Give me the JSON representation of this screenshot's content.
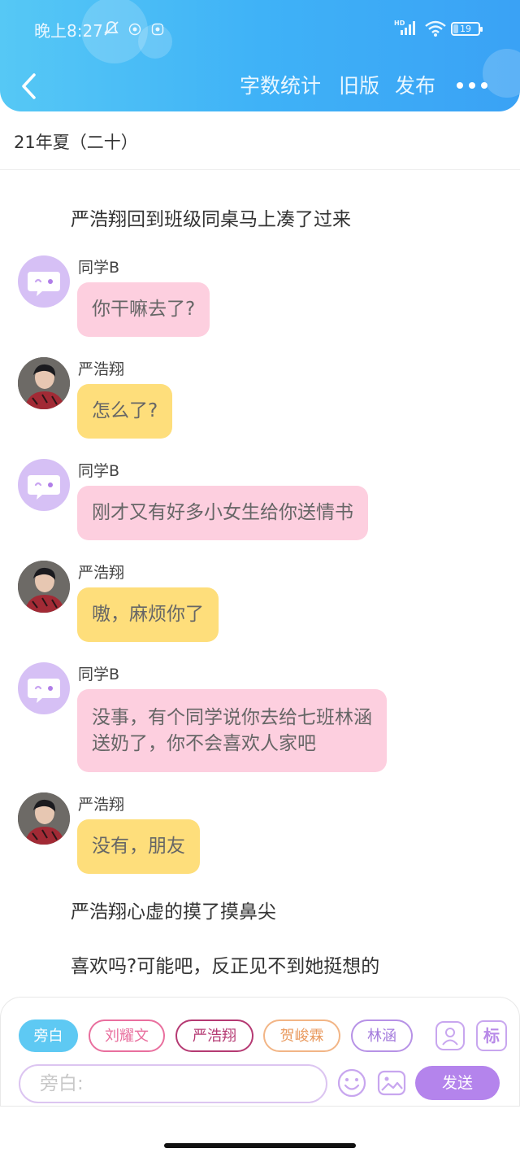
{
  "status_bar": {
    "time": "晚上8:27",
    "battery": "19",
    "battery_level": 0.19,
    "icons": [
      "mute-bell-icon",
      "app-badge-icon",
      "app-badge-icon",
      "hd-signal-icon",
      "wifi-icon",
      "battery-icon"
    ]
  },
  "header": {
    "back_icon": "chevron-left-icon",
    "actions": {
      "word_count": "字数统计",
      "old_version": "旧版",
      "publish": "发布"
    },
    "more_icon": "more-dots-icon",
    "colors": {
      "gradient_start": "#56c8f5",
      "gradient_end": "#3aa2f5"
    }
  },
  "chapter": {
    "title": "21年夏（二十）"
  },
  "story": {
    "items": [
      {
        "kind": "narration",
        "text": "严浩翔回到班级同桌马上凑了过来"
      },
      {
        "kind": "message",
        "speaker": "同学B",
        "avatar": "bot-face-icon",
        "color": "pink",
        "lines": [
          "你干嘛去了?"
        ]
      },
      {
        "kind": "message",
        "speaker": "严浩翔",
        "avatar": "user-photo",
        "color": "yellow",
        "lines": [
          "怎么了?"
        ]
      },
      {
        "kind": "message",
        "speaker": "同学B",
        "avatar": "bot-face-icon",
        "color": "pink",
        "lines": [
          "刚才又有好多小女生给你送情书"
        ]
      },
      {
        "kind": "message",
        "speaker": "严浩翔",
        "avatar": "user-photo",
        "color": "yellow",
        "lines": [
          "嗷，麻烦你了"
        ]
      },
      {
        "kind": "message",
        "speaker": "同学B",
        "avatar": "bot-face-icon",
        "color": "pink",
        "lines": [
          "没事，有个同学说你去给七班林涵",
          "送奶了，你不会喜欢人家吧"
        ]
      },
      {
        "kind": "message",
        "speaker": "严浩翔",
        "avatar": "user-photo",
        "color": "yellow",
        "lines": [
          "没有，朋友"
        ]
      },
      {
        "kind": "narration",
        "text": "严浩翔心虚的摸了摸鼻尖"
      },
      {
        "kind": "narration",
        "text": "喜欢吗?可能吧，反正见不到她挺想的"
      }
    ],
    "bubble_colors": {
      "pink": "#fdcfdf",
      "yellow": "#fede7b"
    }
  },
  "composer": {
    "roles": [
      {
        "label": "旁白",
        "selected": true,
        "color": "#5ec9f3"
      },
      {
        "label": "刘耀文",
        "selected": false,
        "color": "#e96f9e"
      },
      {
        "label": "严浩翔",
        "selected": false,
        "color": "#b53a73"
      },
      {
        "label": "贺峻霖",
        "selected": false,
        "color": "#f2b586"
      },
      {
        "label": "林涵",
        "selected": false,
        "color": "#b792e6"
      }
    ],
    "role_manage_icon": "user-card-icon",
    "tag_label": "标",
    "placeholder": "旁白:",
    "emoji_icon": "smiley-icon",
    "image_icon": "image-icon",
    "send_label": "发送",
    "send_color": "#b484ec"
  }
}
